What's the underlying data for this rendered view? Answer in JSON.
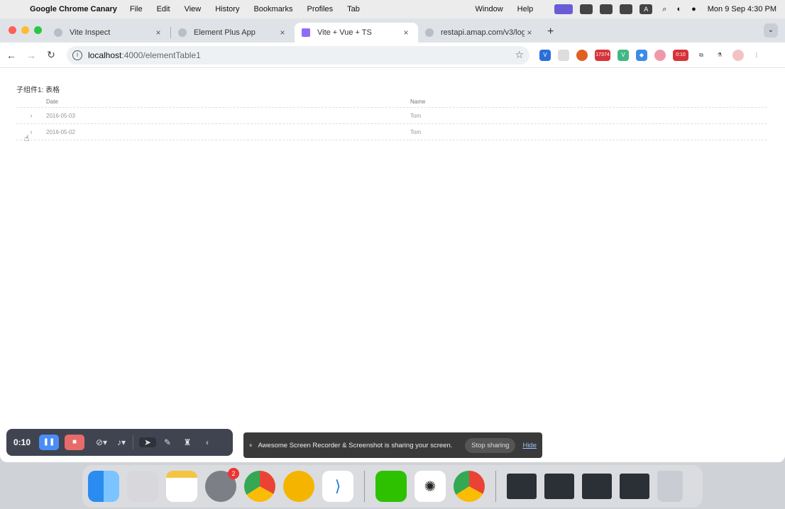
{
  "menubar": {
    "app_name": "Google Chrome Canary",
    "menus": [
      "File",
      "Edit",
      "View",
      "History",
      "Bookmarks",
      "Profiles",
      "Tab"
    ],
    "right_menus": [
      "Window",
      "Help"
    ],
    "clock": "Mon 9 Sep  4:30 PM",
    "status_text": "A"
  },
  "browser": {
    "tabs": [
      {
        "title": "Vite Inspect",
        "active": false
      },
      {
        "title": "Element Plus App",
        "active": false
      },
      {
        "title": "Vite + Vue + TS",
        "active": true
      },
      {
        "title": "restapi.amap.com/v3/log/init?",
        "active": false
      }
    ],
    "url_host": "localhost",
    "url_path": ":4000/elementTable1",
    "extension_badges": [
      "17374",
      "0:10"
    ]
  },
  "page": {
    "component_title": "子组件1: 表格",
    "columns": {
      "date": "Date",
      "name": "Name"
    },
    "rows": [
      {
        "date": "2016-05-03",
        "name": "Tom"
      },
      {
        "date": "2016-05-02",
        "name": "Tom"
      }
    ]
  },
  "recorder": {
    "time": "0:10"
  },
  "share_bar": {
    "message": "Awesome Screen Recorder & Screenshot is sharing your screen.",
    "stop_label": "Stop sharing",
    "hide_label": "Hide"
  },
  "dock": {
    "settings_badge": "2"
  },
  "colors": {
    "pause": "#4b8df7",
    "stop": "#e86a6a",
    "menubar": "#ececec",
    "tabstrip": "#dfe3e8"
  }
}
